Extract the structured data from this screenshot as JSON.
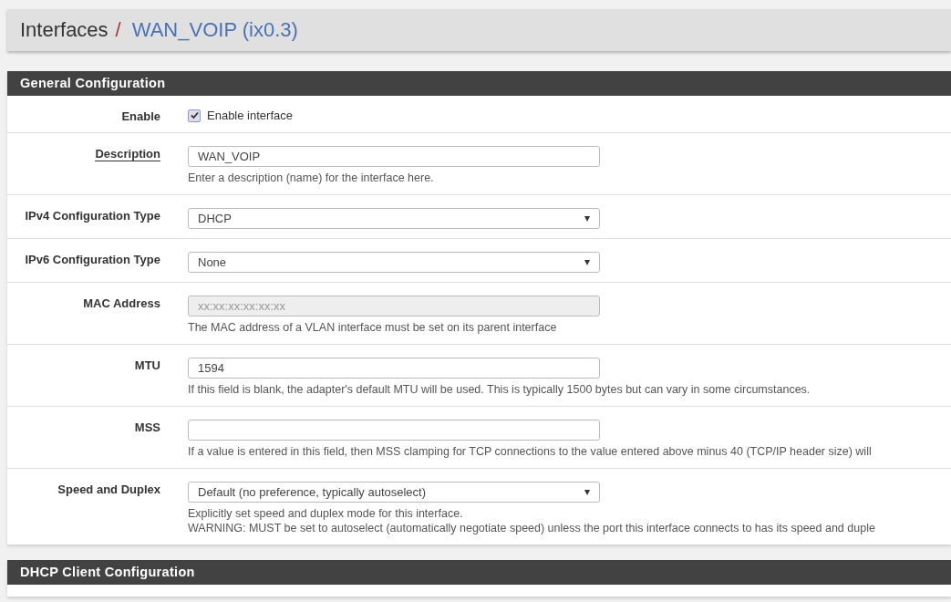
{
  "breadcrumb": {
    "parent": "Interfaces",
    "separator": "/",
    "current": "WAN_VOIP (ix0.3)"
  },
  "sections": [
    {
      "title": "General Configuration",
      "rows": [
        {
          "kind": "checkbox",
          "label": "Enable",
          "underlined": false,
          "checked": true,
          "text": "Enable interface"
        },
        {
          "kind": "input",
          "label": "Description",
          "underlined": true,
          "disabled": false,
          "value": "WAN_VOIP",
          "help": [
            "Enter a description (name) for the interface here."
          ]
        },
        {
          "kind": "select",
          "label": "IPv4 Configuration Type",
          "underlined": false,
          "value": "DHCP"
        },
        {
          "kind": "select",
          "label": "IPv6 Configuration Type",
          "underlined": false,
          "value": "None"
        },
        {
          "kind": "input",
          "label": "MAC Address",
          "underlined": false,
          "disabled": true,
          "placeholder": "xx:xx:xx:xx:xx:xx",
          "help": [
            "The MAC address of a VLAN interface must be set on its parent interface"
          ]
        },
        {
          "kind": "input",
          "label": "MTU",
          "underlined": false,
          "disabled": false,
          "value": "1594",
          "help": [
            "If this field is blank, the adapter's default MTU will be used. This is typically 1500 bytes but can vary in some circumstances."
          ]
        },
        {
          "kind": "input",
          "label": "MSS",
          "underlined": false,
          "disabled": false,
          "help": [
            "If a value is entered in this field, then MSS clamping for TCP connections to the value entered above minus 40 (TCP/IP header size) will"
          ]
        },
        {
          "kind": "select",
          "label": "Speed and Duplex",
          "underlined": false,
          "value": "Default (no preference, typically autoselect)",
          "help": [
            "Explicitly set speed and duplex mode for this interface.",
            "WARNING: MUST be set to autoselect (automatically negotiate speed) unless the port this interface connects to has its speed and duple"
          ]
        }
      ]
    },
    {
      "title": "DHCP Client Configuration"
    }
  ]
}
